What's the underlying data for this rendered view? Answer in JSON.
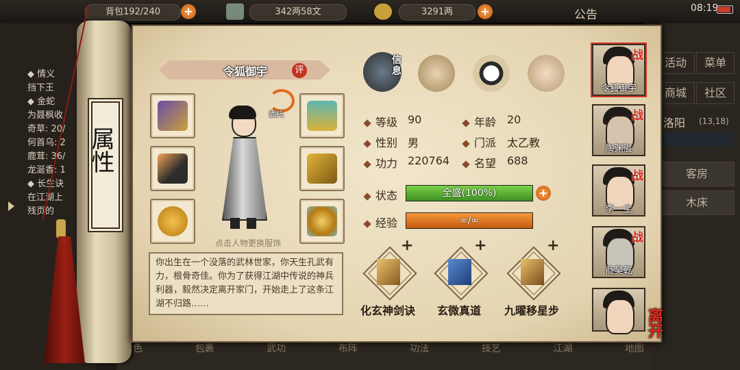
{
  "topbar": {
    "capacity": "背包192/240",
    "silver": "342两58文",
    "gold": "3291两",
    "notice": "公告",
    "time": "08:19"
  },
  "left_panel": {
    "lines": [
      "◆ 情义",
      "挡下王",
      "◆ 金蛇",
      "为聂枫收",
      "奇草: 20/",
      "何首乌: 2",
      "鹿茸: 36/",
      "龙涎香: 1",
      "◆ 长生诀",
      "在江湖上",
      "残页的"
    ]
  },
  "scroll_title": "属性",
  "character": {
    "name": "令狐御宇",
    "rate_badge": "评",
    "entrust": "委托",
    "change_outfit_hint": "点击人物更换服饰",
    "bio": "你出生在一个没落的武林世家，你天生孔武有力，根骨奇佳。你为了获得江湖中传说的神兵利器，毅然决定离开家门，开始走上了这条江湖不归路……"
  },
  "tabs": [
    {
      "label": "信息",
      "icon": "info-tab-icon"
    },
    {
      "label": "",
      "icon": "scroll-tab-icon"
    },
    {
      "label": "",
      "icon": "taiji-tab-icon"
    },
    {
      "label": "",
      "icon": "meridian-tab-icon"
    }
  ],
  "stats": {
    "level_label": "等级",
    "level": "90",
    "age_label": "年龄",
    "age": "20",
    "gender_label": "性别",
    "gender": "男",
    "sect_label": "门派",
    "sect": "太乙教",
    "power_label": "功力",
    "power": "220764",
    "fame_label": "名望",
    "fame": "688",
    "status_label": "状态",
    "status_value": "全盛(100%)",
    "status_fraction": 1.0,
    "exp_label": "经验",
    "exp_value": "∞/∞",
    "exp_fraction": 1.0
  },
  "skills": [
    {
      "name": "化玄神剑诀",
      "icon": "sword-manual-icon"
    },
    {
      "name": "玄微真道",
      "icon": "blue-manual-icon"
    },
    {
      "name": "九曜移星步",
      "icon": "step-manual-icon"
    }
  ],
  "party": [
    {
      "name": "令狐御宇",
      "tag": "战"
    },
    {
      "name": "陶渊溢",
      "tag": "战"
    },
    {
      "name": "李一尘",
      "tag": "战"
    },
    {
      "name": "商昊乾",
      "tag": "战"
    },
    {
      "name": "",
      "tag": ""
    }
  ],
  "right_menu": {
    "buttons": [
      "活动",
      "菜单",
      "商城",
      "社区"
    ],
    "location": "洛阳",
    "coords": "(13,18)",
    "room1": "客房",
    "room2": "木床"
  },
  "leave_label": "离开",
  "bottom_bar": [
    "角色",
    "包裹",
    "武功",
    "布阵",
    "功法",
    "技艺",
    "江湖",
    "地图"
  ],
  "colors": {
    "status_bar": "#4fae2a",
    "exp_bar": "#e7761c",
    "name_banner": "#d9b9a0",
    "war_tag": "#d8271c"
  }
}
